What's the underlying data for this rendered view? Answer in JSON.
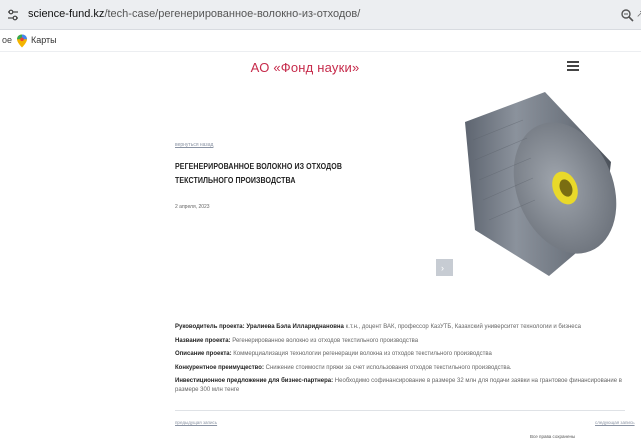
{
  "browser": {
    "url_host": "science-fund.kz",
    "url_path": "/tech-case/регенерированное-волокно-из-отходов/",
    "edge_fragment": "↗",
    "bookmark_fragment": "ое",
    "bookmark_label": "Карты",
    "colors": {
      "bar": "#eceef1",
      "pin": "#f4b400"
    }
  },
  "site": {
    "title": "АО «Фонд науки»",
    "title_color": "#c62a4a"
  },
  "article": {
    "back_link": "вернуться назад",
    "title": "Регенерированное волокно из отходов текстильного производства",
    "date": "2 апреля, 2023",
    "image_nav_arrow": "›"
  },
  "details": [
    {
      "label": "Руководитель проекта:",
      "strong_value": "Уралиева Бэла Иллариднановна",
      "value": " к.т.н., доцент ВАК, профессор КазУТБ, Казахский университет технологии и бизнеса"
    },
    {
      "label": "Название проекта:",
      "strong_value": "",
      "value": " Регенерированное волокно из отходов текстильного производства"
    },
    {
      "label": "Описание проекта:",
      "strong_value": "",
      "value": " Коммерциализация технологии регенерации волокна из отходов текстильного производства"
    },
    {
      "label": "Конкурентное преимущество:",
      "strong_value": "",
      "value": " Снижение стоимости пряжи за счет использования отходов текстильного производства."
    },
    {
      "label": "Инвестиционное предложение для бизнес-партнера:",
      "strong_value": "",
      "value": " Необходимо софинансирование в размере 32 млн для подачи заявки на грантовое финансирование в размере 300 млн тенге"
    }
  ],
  "footer": {
    "prev_link": "предыдущая запись",
    "next_link": "следующая запись",
    "note": "Все права сохранены"
  }
}
